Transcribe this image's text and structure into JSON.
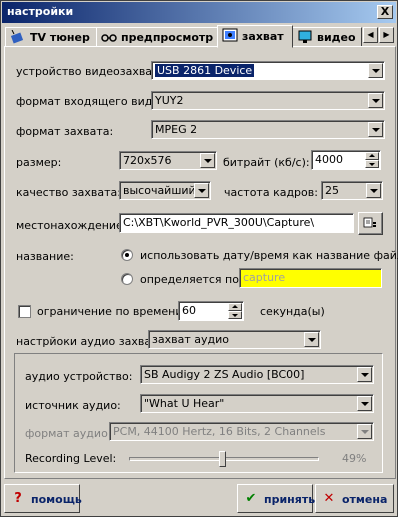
{
  "window": {
    "title": "настройки",
    "close": "X"
  },
  "tabs": [
    {
      "label": "TV тюнер",
      "icon": "tv-tuner-icon"
    },
    {
      "label": "предпросмотр",
      "icon": "glasses-icon"
    },
    {
      "label": "захват",
      "icon": "capture-icon"
    },
    {
      "label": "видео",
      "icon": "monitor-icon"
    }
  ],
  "capture": {
    "device_label": "устройство видеозахвата:",
    "device_value": "USB 2861 Device",
    "input_format_label": "формат входящего видео:",
    "input_format_value": "YUY2",
    "capture_format_label": "формат захвата:",
    "capture_format_value": "MPEG 2",
    "size_label": "размер:",
    "size_value": "720x576",
    "bitrate_label": "битрайт (кб/с):",
    "bitrate_value": "4000",
    "quality_label": "качество захвата:",
    "quality_value": "высочайший",
    "framerate_label": "частота кадров:",
    "framerate_value": "25",
    "location_label": "местонахождение:",
    "location_value": "C:\\XBT\\Kworld_PVR_300U\\Capture\\",
    "name_label": "название:",
    "name_option_datetime": "использовать дату/время как название файла",
    "name_option_custom": "определяется по",
    "name_custom_value": "capture",
    "time_limit_label": "ограничение по времени",
    "time_limit_value": "60",
    "time_limit_unit": "секунда(ы)",
    "audio_settings_label": "настрйоки аудио захвата:",
    "audio_settings_value": "захват аудио"
  },
  "audio": {
    "device_label": "аудио устройство:",
    "device_value": "SB Audigy 2 ZS Audio [BC00]",
    "source_label": "источник аудио:",
    "source_value": "\"What U Hear\"",
    "format_label": "формат аудио:",
    "format_value": "PCM, 44100 Hertz, 16 Bits, 2 Channels",
    "level_label": "Recording Level:",
    "level_value": "49%",
    "level_fraction": 0.49
  },
  "footer": {
    "help": "помощь",
    "accept": "принять",
    "cancel": "отмена"
  },
  "colors": {
    "accent": "#0a246a",
    "highlight": "#ffff00",
    "disabled_text": "#808080"
  }
}
